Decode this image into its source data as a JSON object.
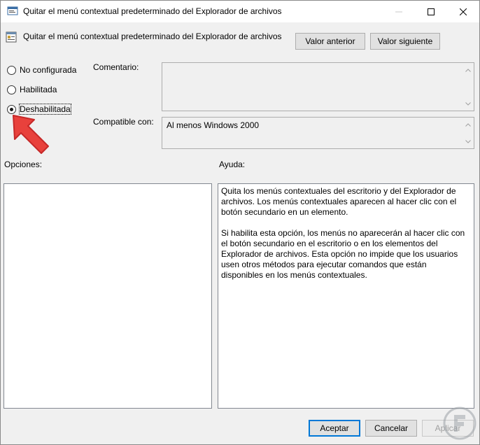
{
  "window": {
    "title": "Quitar el menú contextual predeterminado del Explorador de archivos"
  },
  "header": {
    "title": "Quitar el menú contextual predeterminado del Explorador de archivos",
    "prev_label": "Valor anterior",
    "next_label": "Valor siguiente"
  },
  "state": {
    "options": [
      {
        "label": "No configurada",
        "selected": false
      },
      {
        "label": "Habilitada",
        "selected": false
      },
      {
        "label": "Deshabilitada",
        "selected": true
      }
    ]
  },
  "comment": {
    "label": "Comentario:",
    "value": ""
  },
  "supported": {
    "label": "Compatible con:",
    "value": "Al menos Windows 2000"
  },
  "options_panel": {
    "label": "Opciones:"
  },
  "help_panel": {
    "label": "Ayuda:",
    "paragraphs": [
      "Quita los menús contextuales del escritorio y del Explorador de archivos. Los menús contextuales aparecen al hacer clic con el botón secundario en un elemento.",
      "Si habilita esta opción, los menús no aparecerán al hacer clic con el botón secundario en el escritorio o en los elementos del Explorador de archivos. Esta opción no impide que los usuarios usen otros métodos para ejecutar comandos que están disponibles en los menús contextuales."
    ]
  },
  "footer": {
    "ok_label": "Aceptar",
    "cancel_label": "Cancelar",
    "apply_label": "Aplicar"
  },
  "colors": {
    "accent": "#0078d7",
    "arrow": "#e8413c"
  },
  "icons": [
    "policy-window-icon",
    "minimize-icon",
    "maximize-icon",
    "close-icon",
    "policy-setting-icon",
    "chevron-up-icon",
    "chevron-down-icon",
    "red-arrow-annotation-icon",
    "watermark-logo-icon"
  ]
}
